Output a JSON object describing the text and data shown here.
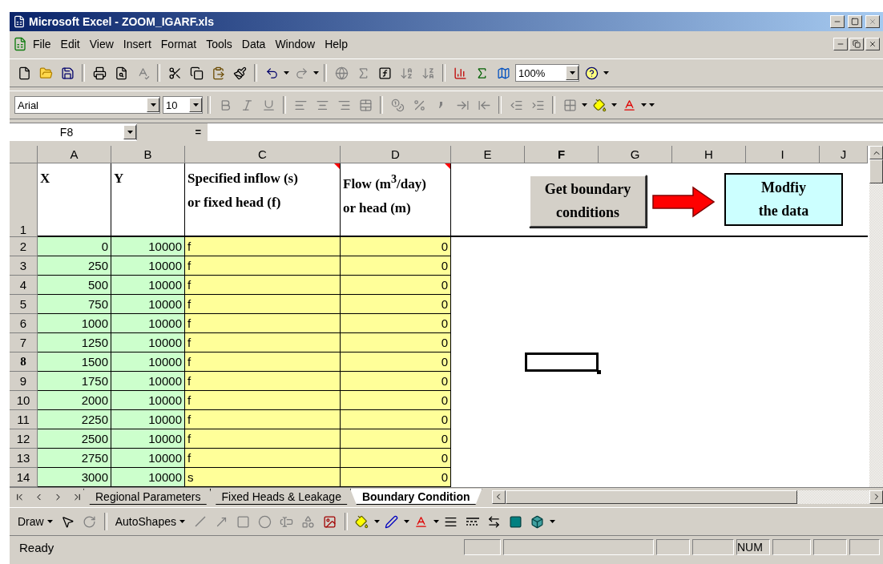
{
  "window": {
    "title": "Microsoft Excel - ZOOM_IGARF.xls"
  },
  "menu": [
    "File",
    "Edit",
    "View",
    "Insert",
    "Format",
    "Tools",
    "Data",
    "Window",
    "Help"
  ],
  "standard_toolbar": {
    "zoom": "100%"
  },
  "formatting_toolbar": {
    "font": "Arial",
    "size": "10"
  },
  "formula_bar": {
    "name_box": "F8",
    "equals": "="
  },
  "sheet": {
    "columns": [
      {
        "label": "A",
        "selected": false
      },
      {
        "label": "B",
        "selected": false
      },
      {
        "label": "C",
        "selected": false
      },
      {
        "label": "D",
        "selected": false
      },
      {
        "label": "E",
        "selected": false
      },
      {
        "label": "F",
        "selected": true
      },
      {
        "label": "G",
        "selected": false
      },
      {
        "label": "H",
        "selected": false
      },
      {
        "label": "I",
        "selected": false
      },
      {
        "label": "J",
        "selected": false
      }
    ],
    "header_row": {
      "number": "1",
      "cells": [
        {
          "lines": [
            "X"
          ],
          "comment": false
        },
        {
          "lines": [
            "Y"
          ],
          "comment": false
        },
        {
          "lines": [
            "Specified inflow (s)",
            "or fixed head (f)"
          ],
          "comment": true
        },
        {
          "lines": [
            "Flow (m$^{3}$/day)",
            "or head (m)"
          ],
          "comment": true
        }
      ]
    },
    "rows": [
      {
        "number": "2",
        "selected": false,
        "cells": [
          "0",
          "10000",
          "f",
          "0"
        ]
      },
      {
        "number": "3",
        "selected": false,
        "cells": [
          "250",
          "10000",
          "f",
          "0"
        ]
      },
      {
        "number": "4",
        "selected": false,
        "cells": [
          "500",
          "10000",
          "f",
          "0"
        ]
      },
      {
        "number": "5",
        "selected": false,
        "cells": [
          "750",
          "10000",
          "f",
          "0"
        ]
      },
      {
        "number": "6",
        "selected": false,
        "cells": [
          "1000",
          "10000",
          "f",
          "0"
        ]
      },
      {
        "number": "7",
        "selected": false,
        "cells": [
          "1250",
          "10000",
          "f",
          "0"
        ]
      },
      {
        "number": "8",
        "selected": true,
        "cells": [
          "1500",
          "10000",
          "f",
          "0"
        ]
      },
      {
        "number": "9",
        "selected": false,
        "cells": [
          "1750",
          "10000",
          "f",
          "0"
        ]
      },
      {
        "number": "10",
        "selected": false,
        "cells": [
          "2000",
          "10000",
          "f",
          "0"
        ]
      },
      {
        "number": "11",
        "selected": false,
        "cells": [
          "2250",
          "10000",
          "f",
          "0"
        ]
      },
      {
        "number": "12",
        "selected": false,
        "cells": [
          "2500",
          "10000",
          "f",
          "0"
        ]
      },
      {
        "number": "13",
        "selected": false,
        "cells": [
          "2750",
          "10000",
          "f",
          "0"
        ]
      },
      {
        "number": "14",
        "selected": false,
        "cells": [
          "3000",
          "10000",
          "s",
          "0"
        ]
      }
    ],
    "buttons": [
      {
        "kind": "grey",
        "lines": [
          "Get boundary",
          "conditions"
        ]
      },
      {
        "kind": "cyan",
        "lines": [
          "Modfiy",
          "the data"
        ]
      }
    ]
  },
  "sheet_tabs": [
    {
      "label": "Regional Parameters",
      "selected": false
    },
    {
      "label": "Fixed Heads & Leakage",
      "selected": false
    },
    {
      "label": "Boundary Condition",
      "selected": true
    }
  ],
  "draw_toolbar": {
    "draw": "Draw",
    "autoshapes": "AutoShapes"
  },
  "status_bar": {
    "text": "Ready",
    "indicator": "NUM"
  }
}
